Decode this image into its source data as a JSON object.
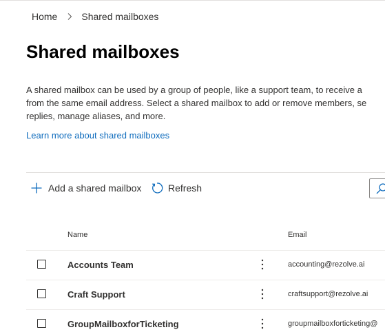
{
  "breadcrumb": {
    "items": [
      "Home",
      "Shared mailboxes"
    ]
  },
  "page": {
    "title": "Shared mailboxes",
    "description": "A shared mailbox can be used by a group of people, like a support team, to receive a\nfrom the same email address. Select a shared mailbox to add or remove members, se\nreplies, manage aliases, and more.",
    "learn_more": "Learn more about shared mailboxes"
  },
  "toolbar": {
    "add_label": "Add a shared mailbox",
    "refresh_label": "Refresh"
  },
  "table": {
    "columns": [
      "Name",
      "Email"
    ],
    "rows": [
      {
        "name": "Accounts Team",
        "email": "accounting@rezolve.ai"
      },
      {
        "name": "Craft Support",
        "email": "craftsupport@rezolve.ai"
      },
      {
        "name": "GroupMailboxforTicketing",
        "email": "groupmailboxforticketing@"
      }
    ]
  },
  "colors": {
    "link": "#0f6cbd",
    "text": "#323130",
    "title": "#000000",
    "divider": "#e1dfdd"
  },
  "icons": {
    "separator": "chevron-right-icon",
    "add": "plus-icon",
    "refresh": "refresh-icon",
    "search": "search-icon",
    "more": "more-vertical-icon"
  }
}
